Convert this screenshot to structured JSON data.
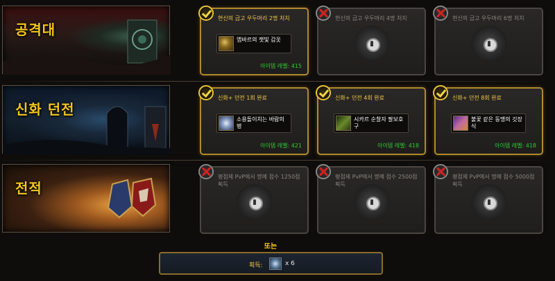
{
  "categories": [
    {
      "title": "공격대",
      "cards": [
        {
          "done": true,
          "caption": "현신의 금고 우두머리 2명 처치",
          "item": "앰바르의 잿빛 갑옷",
          "level": "아이템 레벨: 415"
        },
        {
          "done": false,
          "caption": "현신의 금고 우두머리 4명 처치"
        },
        {
          "done": false,
          "caption": "현신의 금고 우두머리 6명 처치"
        }
      ]
    },
    {
      "title": "신화 던전",
      "cards": [
        {
          "done": true,
          "caption": "신화+ 던전 1회 완료",
          "item": "소용돌이치는 바람의 병",
          "level": "아이템 레벨: 421"
        },
        {
          "done": true,
          "caption": "신화+ 던전 4회 완료",
          "item": "시카르 순찰자 팔보호구",
          "level": "아이템 레벨: 418"
        },
        {
          "done": true,
          "caption": "신화+ 던전 8회 완료",
          "item": "불꽃 같은 동맹의 깃장식",
          "level": "아이템 레벨: 418"
        }
      ]
    },
    {
      "title": "전적",
      "cards": [
        {
          "done": false,
          "caption": "평점제 PvP에서 명예 점수 1250점 획득"
        },
        {
          "done": false,
          "caption": "평점제 PvP에서 명예 점수 2500점 획득"
        },
        {
          "done": false,
          "caption": "평점제 PvP에서 명예 점수 5000점 획득"
        }
      ]
    }
  ],
  "or_label": "또는",
  "bottom": {
    "label": "획득:",
    "quantity": "x 6"
  },
  "colors": {
    "gold": "#f5c71a",
    "green": "#34c934",
    "border_done": "#b08a2d"
  }
}
